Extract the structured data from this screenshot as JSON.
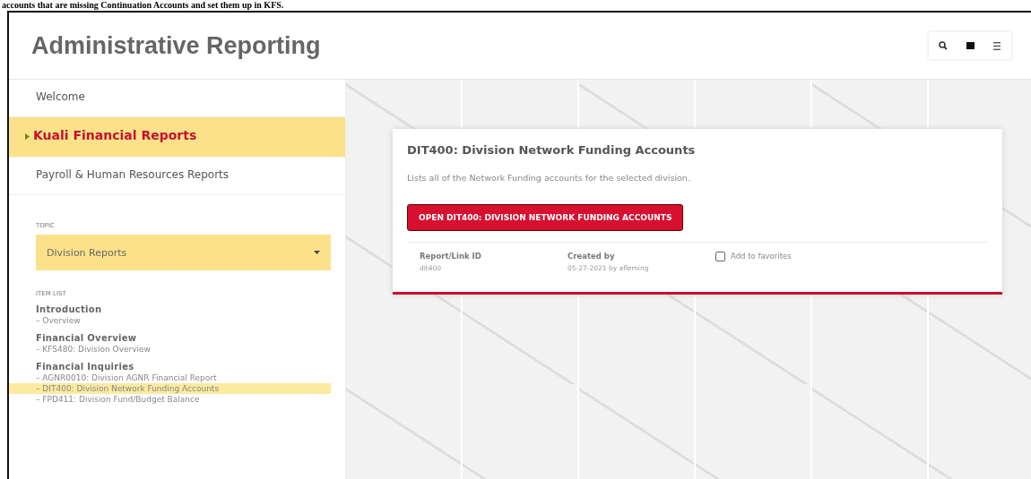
{
  "top_note": "accounts that are missing Continuation Accounts and set them up in KFS.",
  "header": {
    "title": "Administrative Reporting"
  },
  "nav": [
    {
      "label": "Welcome",
      "selected": false
    },
    {
      "label": "Kuali Financial Reports",
      "selected": true
    },
    {
      "label": "Payroll & Human Resources Reports",
      "selected": false
    }
  ],
  "topic": {
    "label": "TOPIC",
    "value": "Division Reports"
  },
  "item_list": {
    "label": "ITEM LIST",
    "groups": [
      {
        "title": "Introduction",
        "items": [
          {
            "label": "– Overview",
            "selected": false
          }
        ]
      },
      {
        "title": "Financial Overview",
        "items": [
          {
            "label": "– KFS480: Division Overview",
            "selected": false
          }
        ]
      },
      {
        "title": "Financial Inquiries",
        "items": [
          {
            "label": "– AGNR0010: Division AGNR Financial Report",
            "selected": false
          },
          {
            "label": "– DIT400: Division Network Funding Accounts",
            "selected": true
          },
          {
            "label": "– FPD411: Division Fund/Budget Balance",
            "selected": false
          }
        ]
      }
    ]
  },
  "card": {
    "title": "DIT400: Division Network Funding Accounts",
    "description": "Lists all of the Network Funding accounts for the selected division.",
    "button": "OPEN DIT400: DIVISION NETWORK FUNDING ACCOUNTS",
    "meta": [
      {
        "label": "Report/Link ID",
        "value": "dit400"
      },
      {
        "label": "Created by",
        "value": "05-27-2021 by afleming"
      }
    ],
    "favorite": {
      "label": "Add to favorites",
      "checked": false
    }
  }
}
